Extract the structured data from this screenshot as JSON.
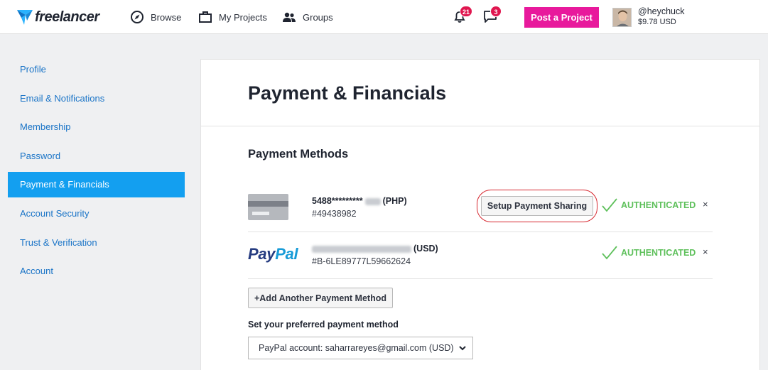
{
  "header": {
    "logo_text": "freelancer",
    "nav": [
      {
        "label": "Browse",
        "icon": "compass-icon"
      },
      {
        "label": "My Projects",
        "icon": "briefcase-icon"
      },
      {
        "label": "Groups",
        "icon": "people-icon"
      }
    ],
    "notifications_count": "21",
    "messages_count": "3",
    "post_project_label": "Post a Project",
    "username": "@heychuck",
    "balance": "$9.78 USD"
  },
  "sidebar": {
    "items": [
      {
        "label": "Profile"
      },
      {
        "label": "Email & Notifications"
      },
      {
        "label": "Membership"
      },
      {
        "label": "Password"
      },
      {
        "label": "Payment & Financials"
      },
      {
        "label": "Account Security"
      },
      {
        "label": "Trust & Verification"
      },
      {
        "label": "Account"
      }
    ],
    "active": "Payment & Financials"
  },
  "main": {
    "title": "Payment & Financials",
    "section_title": "Payment Methods",
    "methods": [
      {
        "name_prefix": "5488*********",
        "currency": "(PHP)",
        "id": "#49438982",
        "setup_label": "Setup Payment Sharing",
        "status": "AUTHENTICATED",
        "remove": "×"
      },
      {
        "logo_part1": "Pay",
        "logo_part2": "Pal",
        "currency": "(USD)",
        "id": "#B-6LE89777L59662624",
        "status": "AUTHENTICATED",
        "remove": "×"
      }
    ],
    "add_method_label": "+Add Another Payment Method",
    "preferred_label": "Set your preferred payment method",
    "preferred_value": "PayPal account: saharrareyes@gmail.com (USD)"
  },
  "colors": {
    "accent_blue": "#139ff0",
    "link_blue": "#1a74c7",
    "post_button": "#e8199c",
    "authenticated_green": "#5ec05b",
    "badge_red": "#e0164f",
    "highlight_ring": "#d6262e"
  }
}
